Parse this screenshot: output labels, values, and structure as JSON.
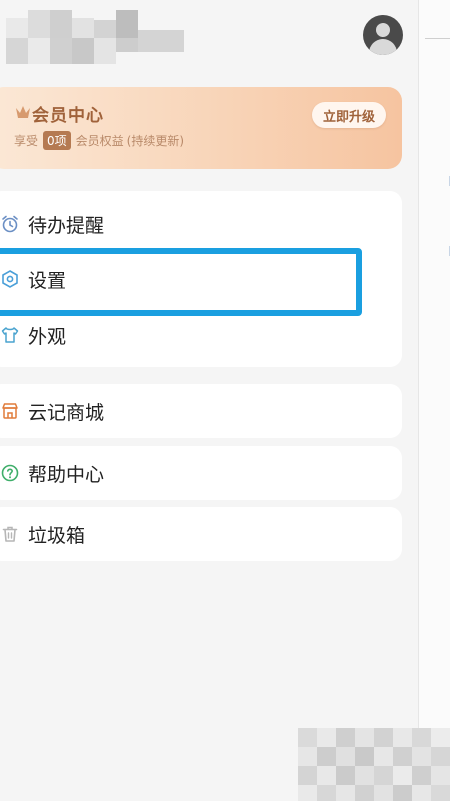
{
  "header": {
    "user_name_obscured": true,
    "avatar_icon": "user-avatar-icon"
  },
  "member": {
    "title": "会员中心",
    "enjoy": "享受",
    "count": "0项",
    "benefits_text": "会员权益",
    "note": "(持续更新)",
    "upgrade_label": "立即升级",
    "icon": "crown-icon",
    "accent": "#a0623a"
  },
  "menu": {
    "todo": {
      "label": "待办提醒",
      "icon": "alarm-clock-icon"
    },
    "settings": {
      "label": "设置",
      "icon": "settings-icon"
    },
    "appearance": {
      "label": "外观",
      "icon": "shirt-icon"
    },
    "store": {
      "label": "云记商城",
      "icon": "store-icon"
    },
    "help": {
      "label": "帮助中心",
      "icon": "help-circle-icon"
    },
    "trash": {
      "label": "垃圾箱",
      "icon": "trash-icon"
    }
  },
  "highlight_color": "#1a9fe0"
}
